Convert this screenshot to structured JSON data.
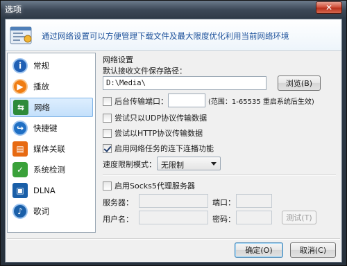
{
  "window": {
    "title": "选项",
    "close_glyph": "✕"
  },
  "banner": {
    "text": "通过网络设置可以方便管理下载文件及最大限度优化利用当前网络环境"
  },
  "nav": {
    "items": [
      {
        "label": "常规",
        "icon": "info-icon",
        "color": "#1f5fb4"
      },
      {
        "label": "播放",
        "icon": "play-icon",
        "color": "#f07d12"
      },
      {
        "label": "网络",
        "icon": "network-icon",
        "color": "#2e8b3a"
      },
      {
        "label": "快捷键",
        "icon": "shortcut-icon",
        "color": "#1f6fc4"
      },
      {
        "label": "媒体关联",
        "icon": "media-association-icon",
        "color": "#e76a12"
      },
      {
        "label": "系统检测",
        "icon": "system-check-icon",
        "color": "#3aa13a"
      },
      {
        "label": "DLNA",
        "icon": "dlna-icon",
        "color": "#1a5fa8"
      },
      {
        "label": "歌词",
        "icon": "lyrics-icon",
        "color": "#1a5fa8"
      }
    ],
    "selected_index": 2
  },
  "network": {
    "section_title": "网络设置",
    "save_path_label": "默认接收文件保存路径：",
    "save_path_value": "D:\\Media\\",
    "browse_button": "浏览(B)",
    "backend_port_label": "后台传输端口：",
    "backend_port_checked": false,
    "backend_port_value": "",
    "port_range_note": "(范围：1-65535 重启系统后生效)",
    "udp_only_label": "尝试只以UDP协议传输数据",
    "udp_only_checked": false,
    "http_label": "尝试以HTTP协议传输数据",
    "http_checked": false,
    "continuous_play_label": "启用网络任务的连下连播功能",
    "continuous_play_checked": true,
    "speed_limit_label": "速度限制模式：",
    "speed_limit_value": "无限制"
  },
  "socks5": {
    "enable_label": "启用Socks5代理服务器",
    "enabled": false,
    "server_label": "服务器：",
    "server_value": "",
    "port_label": "端口：",
    "port_value": "",
    "username_label": "用户名：",
    "username_value": "",
    "password_label": "密码：",
    "password_value": "",
    "test_button": "测试(T)"
  },
  "footer": {
    "ok_button": "确定(O)",
    "cancel_button": "取消(C)"
  }
}
